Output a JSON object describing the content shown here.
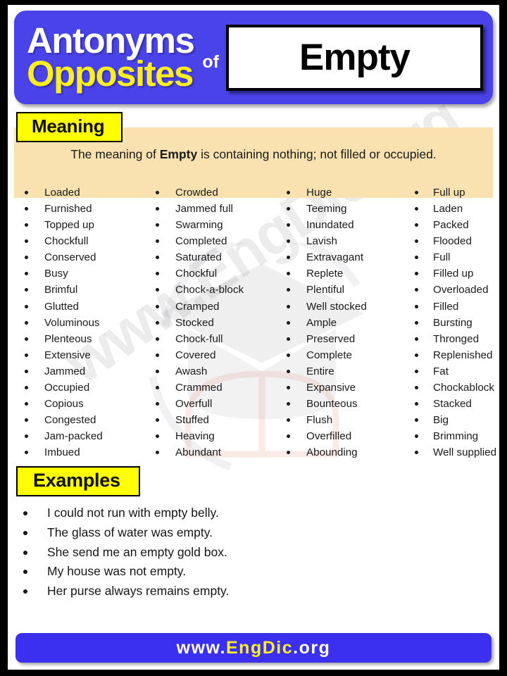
{
  "header": {
    "line1": "Antonyms",
    "line2": "Opposites",
    "connector": "of",
    "word": "Empty",
    "banner_color": "#4a43ea",
    "line1_color": "#ffffff",
    "line2_color": "#ffef20"
  },
  "meaning": {
    "label": "Meaning",
    "label_bg": "#ffff00",
    "panel_bg": "#fae1b0",
    "text_prefix": "The meaning of ",
    "text_word": "Empty",
    "text_suffix": " is containing nothing; not filled or occupied."
  },
  "words": {
    "columns": [
      {
        "items": [
          "Loaded",
          "Furnished",
          "Topped up",
          "Chockfull",
          "Conserved",
          "Busy",
          "Brimful",
          "Glutted",
          "Voluminous",
          "Plenteous",
          "Extensive",
          "Jammed",
          "Occupied",
          "Copious",
          "Congested",
          "Jam-packed",
          "Imbued"
        ]
      },
      {
        "items": [
          "Crowded",
          "Jammed full",
          "Swarming",
          "Completed",
          "Saturated",
          "Chockful",
          "Chock-a-block",
          "Cramped",
          "Stocked",
          "Chock-full",
          "Covered",
          "Awash",
          "Crammed",
          "Overfull",
          "Stuffed",
          "Heaving",
          "Abundant"
        ]
      },
      {
        "items": [
          "Huge",
          "Teeming",
          "Inundated",
          "Lavish",
          "Extravagant",
          "Replete",
          "Plentiful",
          "Well stocked",
          "Ample",
          "Preserved",
          "Complete",
          "Entire",
          "Expansive",
          "Bounteous",
          "Flush",
          "Overfilled",
          "Abounding"
        ]
      },
      {
        "items": [
          "Full up",
          "Laden",
          "Packed",
          "Flooded",
          "Full",
          "Filled up",
          "Overloaded",
          "Filled",
          "Bursting",
          "Thronged",
          "Replenished",
          "Fat",
          "Chockablock",
          "Stacked",
          "Big",
          "Brimming",
          "Well supplied"
        ]
      }
    ]
  },
  "examples": {
    "label": "Examples",
    "label_bg": "#ffff00",
    "items": [
      "I could not run with empty belly.",
      "The glass of water was empty.",
      "She send me an empty gold box.",
      "My house was not empty.",
      "Her purse always remains empty."
    ]
  },
  "footer": {
    "part1": "www.",
    "part2": "EngDic",
    "part3": ".org",
    "bg": "#3b2ff0",
    "part1_color": "#ffffff",
    "part2_color": "#ffef20"
  },
  "watermark": {
    "text": "www.EngDic.org"
  }
}
